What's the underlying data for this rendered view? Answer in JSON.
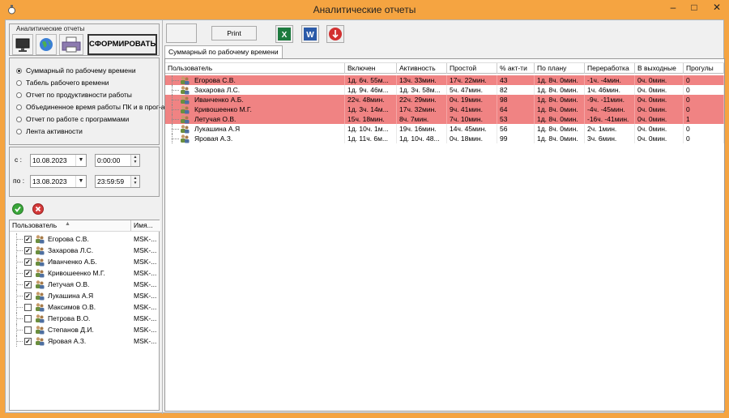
{
  "window": {
    "title": "Аналитические отчеты",
    "minimize": "–",
    "maximize": "□",
    "close": "✕"
  },
  "left": {
    "group_label": "Аналитические отчеты",
    "form_button": "СФОРМИРОВАТЬ",
    "report_types": [
      {
        "label": "Суммарный по рабочему времени",
        "selected": true
      },
      {
        "label": "Табель рабочего времени",
        "selected": false
      },
      {
        "label": "Отчет по продуктивности работы",
        "selected": false
      },
      {
        "label": "Объединенное время работы ПК и в прог-ах",
        "selected": false
      },
      {
        "label": "Отчет по работе с программами",
        "selected": false
      },
      {
        "label": "Лента активности",
        "selected": false
      }
    ],
    "from_label": "с :",
    "to_label": "по :",
    "date_from": "10.08.2023",
    "time_from": "0:00:00",
    "date_to": "13.08.2023",
    "time_to": "23:59:59",
    "user_list": {
      "col_user": "Пользователь",
      "col_name": "Имя...",
      "rows": [
        {
          "name": "Егорова С.В.",
          "host": "MSK-...",
          "checked": true
        },
        {
          "name": "Захарова Л.С.",
          "host": "MSK-...",
          "checked": true
        },
        {
          "name": "Иванченко А.Б.",
          "host": "MSK-...",
          "checked": true
        },
        {
          "name": "Кривошеенко М.Г.",
          "host": "MSK-...",
          "checked": true
        },
        {
          "name": "Летучая О.В.",
          "host": "MSK-...",
          "checked": true
        },
        {
          "name": "Лукашина А.Я",
          "host": "MSK-...",
          "checked": true
        },
        {
          "name": "Максимов О.В.",
          "host": "MSK-...",
          "checked": false
        },
        {
          "name": "Петрова В.О.",
          "host": "MSK-...",
          "checked": false
        },
        {
          "name": "Степанов Д.И.",
          "host": "MSK-...",
          "checked": false
        },
        {
          "name": "Яровая А.З.",
          "host": "MSK-...",
          "checked": true
        }
      ]
    }
  },
  "toolbar": {
    "print_label": "Print"
  },
  "tab_label": "Суммарный по рабочему времени",
  "grid": {
    "columns": [
      "Пользователь",
      "Включен",
      "Активность",
      "Простой",
      "% акт-ти",
      "По плану",
      "Переработка",
      "В выходные",
      "Прогулы"
    ],
    "rows": [
      {
        "highlight": true,
        "cells": [
          "Егорова С.В.",
          "1д. 6ч. 55м...",
          "13ч. 33мин.",
          "17ч. 22мин.",
          "43",
          "1д. 8ч. 0мин.",
          "-1ч. -4мин.",
          "0ч. 0мин.",
          "0"
        ]
      },
      {
        "highlight": false,
        "cells": [
          "Захарова Л.С.",
          "1д. 9ч. 46м...",
          "1д. 3ч. 58м...",
          "5ч. 47мин.",
          "82",
          "1д. 8ч. 0мин.",
          "1ч. 46мин.",
          "0ч. 0мин.",
          "0"
        ]
      },
      {
        "highlight": true,
        "cells": [
          "Иванченко А.Б.",
          "22ч. 48мин.",
          "22ч. 29мин.",
          "0ч. 19мин.",
          "98",
          "1д. 8ч. 0мин.",
          "-9ч. -11мин.",
          "0ч. 0мин.",
          "0"
        ]
      },
      {
        "highlight": true,
        "cells": [
          "Кривошеенко М.Г.",
          "1д. 3ч. 14м...",
          "17ч. 32мин.",
          "9ч. 41мин.",
          "64",
          "1д. 8ч. 0мин.",
          "-4ч. -45мин.",
          "0ч. 0мин.",
          "0"
        ]
      },
      {
        "highlight": true,
        "cells": [
          "Летучая О.В.",
          "15ч. 18мин.",
          "8ч. 7мин.",
          "7ч. 10мин.",
          "53",
          "1д. 8ч. 0мин.",
          "-16ч. -41мин.",
          "0ч. 0мин.",
          "1"
        ]
      },
      {
        "highlight": false,
        "cells": [
          "Лукашина А.Я",
          "1д. 10ч. 1м...",
          "19ч. 16мин.",
          "14ч. 45мин.",
          "56",
          "1д. 8ч. 0мин.",
          "2ч. 1мин.",
          "0ч. 0мин.",
          "0"
        ]
      },
      {
        "highlight": false,
        "cells": [
          "Яровая А.З.",
          "1д. 11ч. 6м...",
          "1д. 10ч. 48...",
          "0ч. 18мин.",
          "99",
          "1д. 8ч. 0мин.",
          "3ч. 6мин.",
          "0ч. 0мин.",
          "0"
        ]
      }
    ]
  }
}
